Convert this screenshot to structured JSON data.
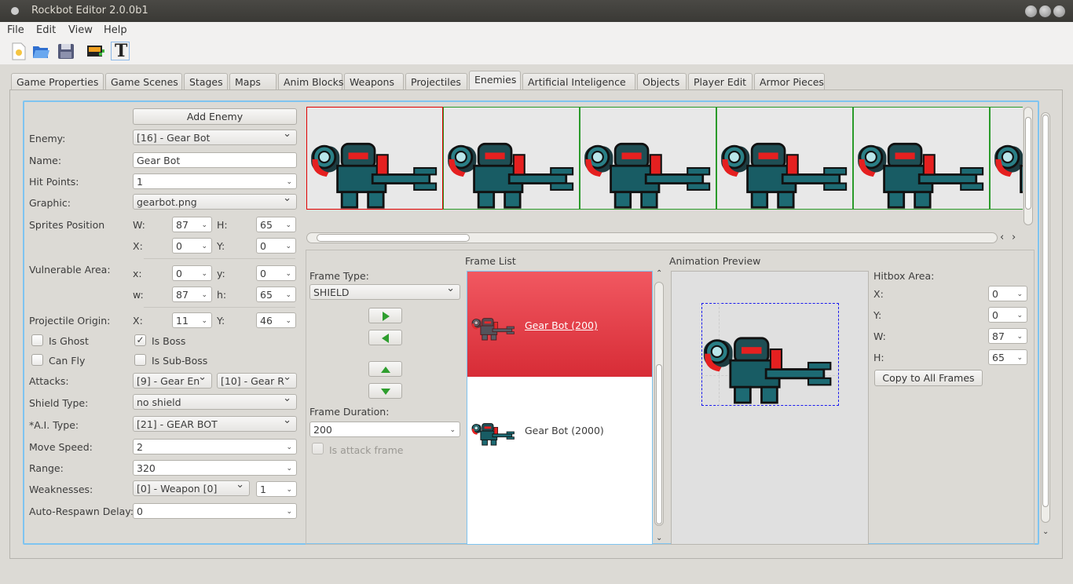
{
  "window": {
    "title": "Rockbot Editor 2.0.0b1"
  },
  "menu": [
    "File",
    "Edit",
    "View",
    "Help"
  ],
  "toolbar": {
    "icons": [
      "new-file-icon",
      "open-folder-icon",
      "save-icon",
      "add-image-icon",
      "text-icon"
    ]
  },
  "tabs": [
    "Game Properties",
    "Game Scenes",
    "Stages",
    "Maps",
    "Anim Blocks",
    "Weapons",
    "Projectiles",
    "Enemies",
    "Artificial Inteligence",
    "Objects",
    "Player Edit",
    "Armor Pieces"
  ],
  "active_tab": "Enemies",
  "form": {
    "add_enemy": "Add Enemy",
    "enemy_label": "Enemy:",
    "enemy_value": "[16] - Gear Bot",
    "name_label": "Name:",
    "name_value": "Gear Bot",
    "hp_label": "Hit Points:",
    "hp_value": "1",
    "graphic_label": "Graphic:",
    "graphic_value": "gearbot.png",
    "sprites_label": "Sprites Position",
    "w_label": "W:",
    "w_value": "87",
    "h_label": "H:",
    "h_value": "65",
    "x_label": "X:",
    "x_value": "0",
    "y_label": "Y:",
    "y_value": "0",
    "vuln_label": "Vulnerable Area:",
    "vx_label": "x:",
    "vx_value": "0",
    "vy_label": "y:",
    "vy_value": "0",
    "vw_label": "w:",
    "vw_value": "87",
    "vh_label": "h:",
    "vh_value": "65",
    "proj_label": "Projectile Origin:",
    "px_label": "X:",
    "px_value": "11",
    "py_label": "Y:",
    "py_value": "46",
    "is_ghost": "Is Ghost",
    "is_boss": "Is Boss",
    "can_fly": "Can Fly",
    "is_subboss": "Is Sub-Boss",
    "is_ghost_checked": false,
    "is_boss_checked": true,
    "can_fly_checked": false,
    "is_subboss_checked": false,
    "attacks_label": "Attacks:",
    "attack1": "[9] - Gear En",
    "attack2": "[10] - Gear R",
    "shield_label": "Shield Type:",
    "shield_value": "no shield",
    "ai_label": "*A.I. Type:",
    "ai_value": "[21] - GEAR BOT",
    "speed_label": "Move Speed:",
    "speed_value": "2",
    "range_label": "Range:",
    "range_value": "320",
    "weak_label": "Weaknesses:",
    "weak_value": "[0] - Weapon [0]",
    "weak_amount": "1",
    "respawn_label": "Auto-Respawn Delay:",
    "respawn_value": "0"
  },
  "frames": {
    "type_label": "Frame Type:",
    "type_value": "SHIELD",
    "duration_label": "Frame Duration:",
    "duration_value": "200",
    "attack_frame": "Is attack frame",
    "attack_frame_checked": false,
    "list_label": "Frame List",
    "items": [
      {
        "label": "Gear Bot (200)"
      },
      {
        "label": "Gear Bot (2000)"
      }
    ]
  },
  "preview": {
    "label": "Animation Preview"
  },
  "hitbox": {
    "label": "Hitbox Area:",
    "x_label": "X:",
    "x_value": "0",
    "y_label": "Y:",
    "y_value": "0",
    "w_label": "W:",
    "w_value": "87",
    "h_label": "H:",
    "h_value": "65",
    "copy": "Copy to All Frames"
  },
  "colors": {
    "selection": "#e0303a",
    "focus": "#7fc4f0",
    "titlebar": "#3c3b37"
  }
}
